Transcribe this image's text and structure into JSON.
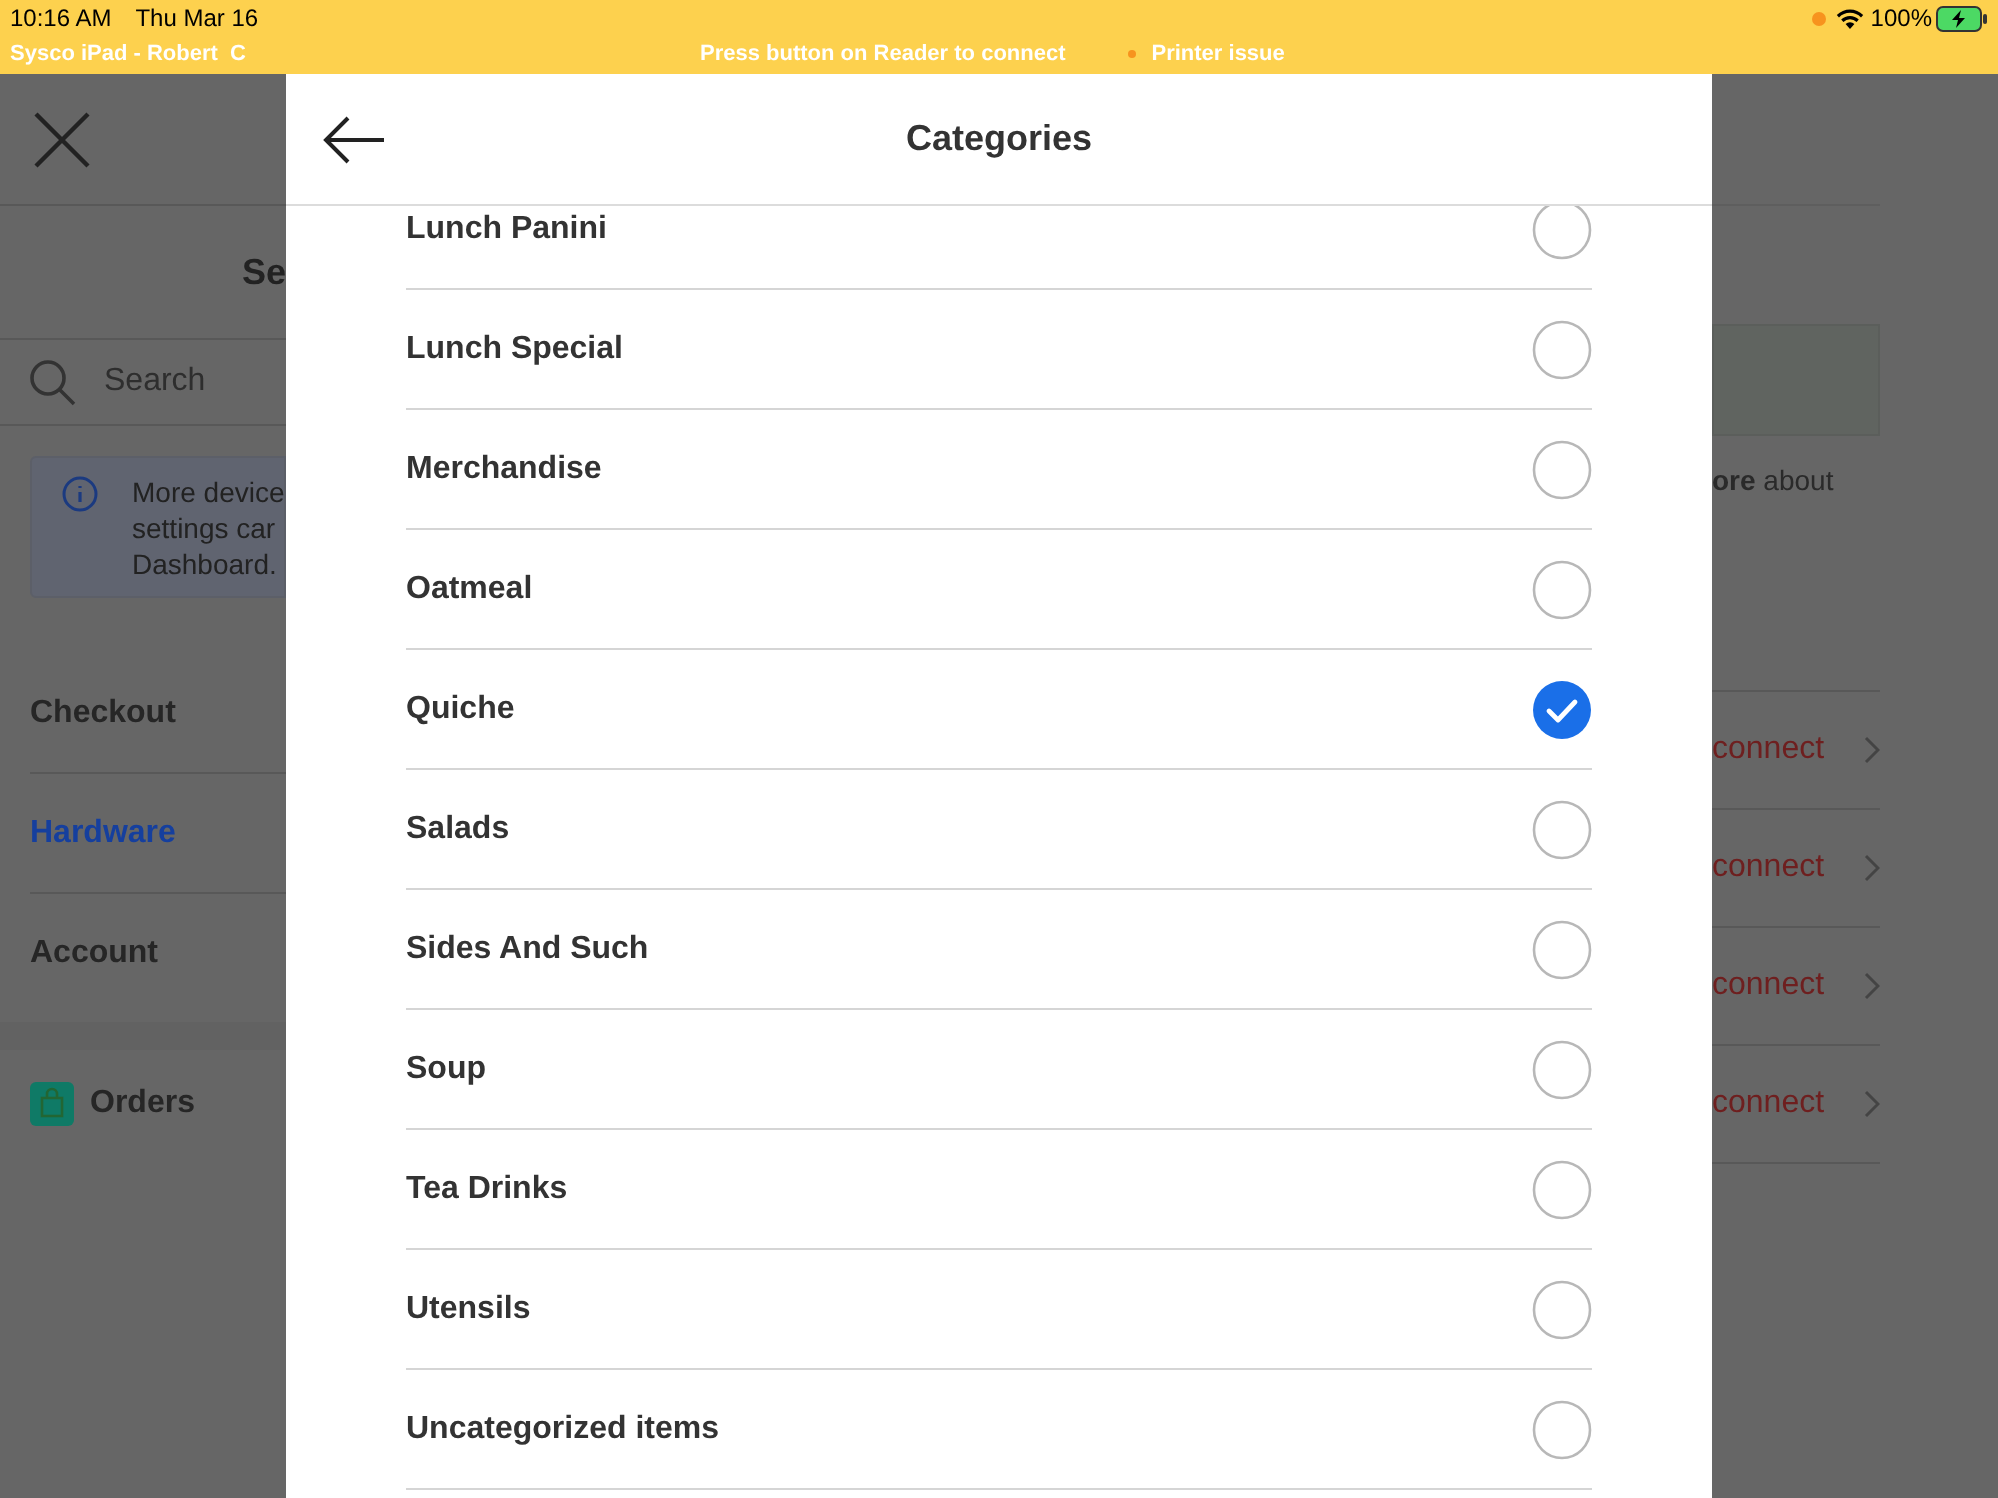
{
  "status_bar": {
    "time": "10:16 AM",
    "date": "Thu Mar 16",
    "battery": "100%",
    "device": "Sysco iPad - Robert  C",
    "reader_message": "Press button on Reader to connect",
    "printer_status": "Printer issue"
  },
  "background": {
    "title": "Se",
    "search": {
      "placeholder": "Search"
    },
    "info_lines": [
      "More device",
      "settings car",
      "Dashboard."
    ],
    "nav": [
      {
        "label": "Checkout",
        "selected": false
      },
      {
        "label": "Hardware",
        "selected": true
      },
      {
        "label": "Account",
        "selected": false
      }
    ],
    "orders": "Orders",
    "learn_more": "**ore** about",
    "device_actions": [
      "connect",
      "connect",
      "connect",
      "connect"
    ]
  },
  "modal": {
    "title": "Categories",
    "items": [
      {
        "label": "Lunch Panini",
        "selected": false
      },
      {
        "label": "Lunch Special",
        "selected": false
      },
      {
        "label": "Merchandise",
        "selected": false
      },
      {
        "label": "Oatmeal",
        "selected": false
      },
      {
        "label": "Quiche",
        "selected": true
      },
      {
        "label": "Salads",
        "selected": false
      },
      {
        "label": "Sides And Such",
        "selected": false
      },
      {
        "label": "Soup",
        "selected": false
      },
      {
        "label": "Tea Drinks",
        "selected": false
      },
      {
        "label": "Utensils",
        "selected": false
      },
      {
        "label": "Uncategorized items",
        "selected": false
      }
    ]
  }
}
